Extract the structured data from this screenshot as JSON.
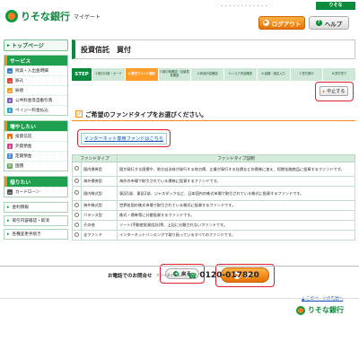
{
  "header": {
    "logo": "りそな銀行",
    "sub": "マイゲート",
    "slogan": "・・・・・・・・・・・・",
    "brand_small": "りそな",
    "logout": "ログアウト",
    "help": "ヘルプ"
  },
  "sidebar": {
    "top_page": "トップページ",
    "sections": [
      {
        "title": "サービス",
        "items": [
          "残高・入出金明細",
          "振込",
          "振替",
          "公共料金等自動引落",
          "ペイジー料金払込"
        ]
      },
      {
        "title": "増やしたい",
        "items": [
          "投資信託",
          "外貨預金",
          "定期預金",
          "国債"
        ]
      },
      {
        "title": "借りたい",
        "items": [
          "カードローン"
        ]
      }
    ],
    "links": [
      "金利情報",
      "取引内容確認・取消",
      "各種変更手続き"
    ]
  },
  "main": {
    "title": "投資信託　買付",
    "step_label": "STEP",
    "steps": [
      "1.取引口座・カード",
      "2.買付ファンド選択",
      "3.取引時確認・目論見書確認",
      "4.商品内容確認",
      "5.リスク内容確認",
      "6.金額・指定入力",
      "7.買付実行",
      "8.買付完了"
    ],
    "active_step": 1,
    "stop_button": "中止する",
    "instruction": "ご希望のファンドタイプをお選びください。",
    "net_link": "インターネット専用ファンドはこちら",
    "table": {
      "headers": [
        "ファンドタイプ",
        "ファンドタイプ説明"
      ],
      "rows": [
        {
          "type": "国内債券型",
          "desc": "国が発行する国債や、地方自治体が発行する地方債、企業が発行する社債などの債券に加え、短期金融商品に投資するファンドです。"
        },
        {
          "type": "海外債券型",
          "desc": "海外の市場で取引されている債券に投資するファンドです。"
        },
        {
          "type": "国内株式型",
          "desc": "東証1部、東証2部、ジャスダックなど、日本国内の株式市場で取引されている株式に投資するファンドです。"
        },
        {
          "type": "海外株式型",
          "desc": "世界各国の株式市場で取引されている株式に投資するファンドです。"
        },
        {
          "type": "バランス型",
          "desc": "株式・債券等に分散投資するファンドです。"
        },
        {
          "type": "その他",
          "desc": "リート(不動産投資信託)等、上記に分類されないファンドです。"
        },
        {
          "type": "全ファンド",
          "desc": "インターネットバンキングで取り扱っているすべてのファンドです。"
        }
      ]
    },
    "back_button": "戻る",
    "next_button": "次へ",
    "page_top": "このページの先頭へ"
  },
  "footer": {
    "contact_label": "お電話でのお問合せ",
    "free_dial": "フリーダイヤル",
    "phone": "0120-017820",
    "logo": "りそな銀行"
  }
}
